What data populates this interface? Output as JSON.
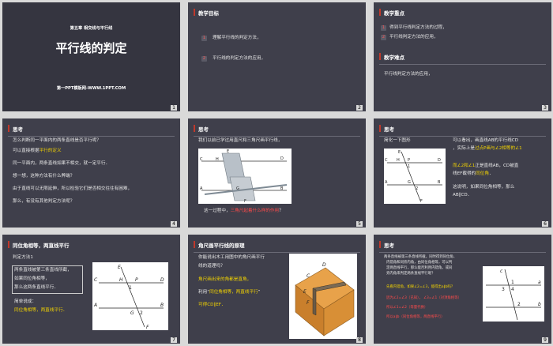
{
  "s1": {
    "chapter": "第五章 相交线与平行线",
    "title": "平行线的判定",
    "site": "第一PPT模板网-WWW.1PPT.COM",
    "num": "1"
  },
  "s2": {
    "title": "教学目标",
    "items": [
      "理解平行线的判定方法，",
      "平行线的判定方法的应用，"
    ],
    "idx": [
      "1",
      "2"
    ],
    "num": "2"
  },
  "s3": {
    "title1": "教学重点",
    "items": [
      "得到平行线判定方法的过程，",
      "平行线判定方法的应用，"
    ],
    "idx": [
      "1",
      "2"
    ],
    "title2": "教学难点",
    "difficulty": "平行线判定方法的应用，",
    "num": "3"
  },
  "s4": {
    "title": "思考",
    "lines": [
      "怎么判断同一平面内的两条直线是否平行呢？",
      "可以直接根据",
      "平行的定义",
      "同一平面内，两条直线如果不相交，就一定平行．",
      "想一想，这种方法有什么弊端？",
      "由于直线可以无限延伸，所以检验它们是否相交往往有困难，",
      "那么，有没有其他判定方法呢？"
    ],
    "num": "4"
  },
  "s5": {
    "title": "思考",
    "intro": "我们以前已学过用直尺和三角尺画平行线，",
    "caption_a": "这一过程中，",
    "caption_b": "三角尺起着什么样的作用",
    "caption_c": "？",
    "labels": [
      "C",
      "H",
      "B",
      "D",
      "A",
      "G",
      "F",
      "E"
    ],
    "num": "5"
  },
  "s6": {
    "title": "思考",
    "intro": "简化一下图形",
    "r1": "可以看出，画直线AB的平行线CD",
    "r2a": "，实际上是",
    "r2b": "过点P画与∠2相等的∠1",
    "r3a": "而∠2和∠1",
    "r3b": "正是直线AB，CD被直",
    "r4a": "线EF截得的",
    "r4b": "同位角",
    "r4c": "．",
    "r5": "这说明，如果同位角相等，那么",
    "r6": "AB∥CD．",
    "labels": [
      "C",
      "H",
      "1",
      "D",
      "A",
      "2",
      "B",
      "E",
      "P",
      "G",
      "F"
    ],
    "num": "6"
  },
  "s7": {
    "title": "同位角相等，两直线平行",
    "sub": "判定方法1",
    "box": [
      "两条直线被第三条直线所截，",
      "如果同位角相等，",
      "那么这两条直线平行．"
    ],
    "short": "简单说成：",
    "rule": "同位角相等，两直线平行．",
    "labels": [
      "E",
      "C",
      "H",
      "P",
      "D",
      "1",
      "A",
      "G",
      "2",
      "B",
      "F"
    ],
    "num": "7"
  },
  "s8": {
    "title": "角尺画平行线的原理",
    "l1": "你能说出木工用图中的角尺画平行",
    "l2": "线的道理吗？",
    "l3": "角尺画出来的角都是直角，",
    "l4a": "利用“",
    "l4b": "同位角相等，两直线平行",
    "l4c": "”",
    "l5": "可得CD∥EF．",
    "labels": [
      "C",
      "D",
      "E",
      "F"
    ],
    "num": "8"
  },
  "s9": {
    "title": "思考",
    "p1": "两条直线被第三条直线所截，同时得到同位角、",
    "p2": "内错角和同旁内角，由同位角相等，可以判",
    "p3": "定两直线平行，那么能否利用内错角，或同",
    "p4": "旁内角来判定两条直线平行呢？",
    "q1": "先看内错角，如果∠2=∠3，能得出a∥b吗？",
    "q2a": "因为∠2=∠3",
    "q2b": "（已知），",
    "q2c": "∠3=∠1",
    "q2d": "（对顶角相等）",
    "q3a": "所以∠1=∠2",
    "q3b": "（等量代换）",
    "q4a": "所以a∥b",
    "q4b": "（同位角相等，两直线平行）",
    "labels": [
      "c",
      "a",
      "1",
      "3",
      "4",
      "b",
      "2"
    ],
    "num": "9"
  }
}
